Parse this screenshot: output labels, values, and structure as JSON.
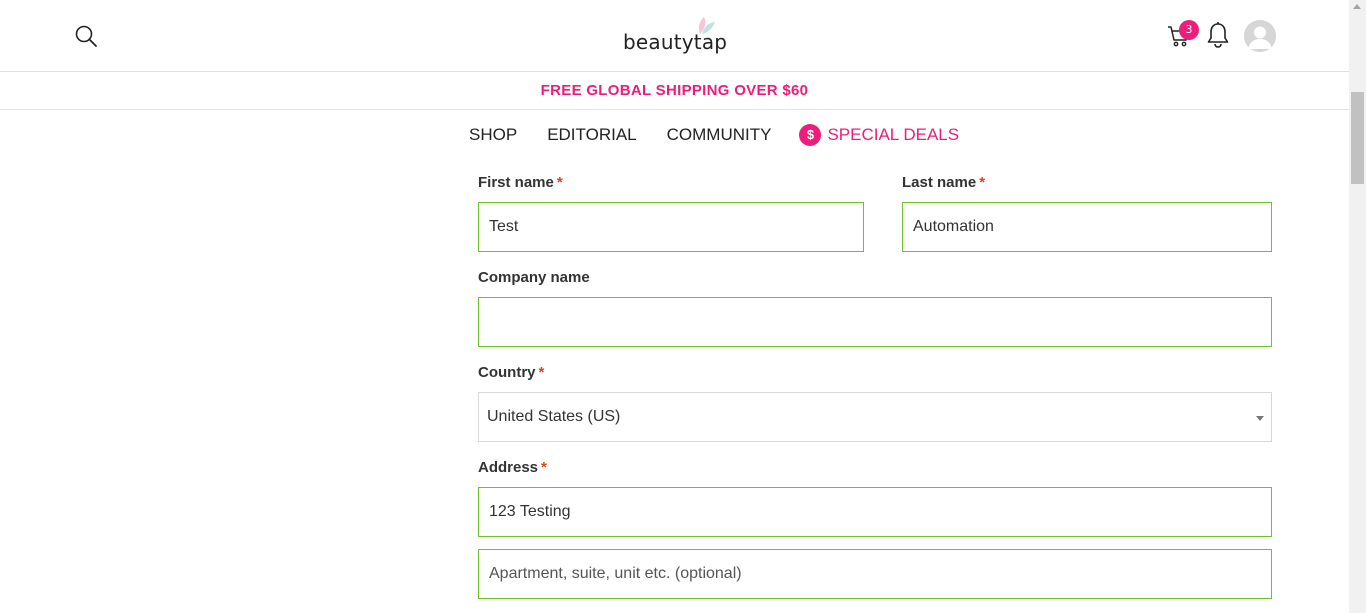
{
  "header": {
    "logo_text": "beautytap",
    "cart_count": "3",
    "icons": {
      "search": "search-icon",
      "cart": "cart-icon",
      "bell": "bell-icon",
      "avatar": "user-avatar-icon"
    }
  },
  "promo": {
    "text": "FREE GLOBAL SHIPPING OVER $60"
  },
  "nav": {
    "items": [
      {
        "label": "SHOP"
      },
      {
        "label": "EDITORIAL"
      },
      {
        "label": "COMMUNITY"
      },
      {
        "label": "SPECIAL DEALS",
        "icon_glyph": "$"
      }
    ]
  },
  "form": {
    "first_name": {
      "label": "First name",
      "required_mark": "*",
      "value": "Test"
    },
    "last_name": {
      "label": "Last name",
      "required_mark": "*",
      "value": "Automation"
    },
    "company": {
      "label": "Company name",
      "value": ""
    },
    "country": {
      "label": "Country",
      "required_mark": "*",
      "selected": "United States (US)"
    },
    "address": {
      "label": "Address",
      "required_mark": "*",
      "line1_value": "123 Testing",
      "line2_placeholder": "Apartment, suite, unit etc. (optional)"
    }
  },
  "colors": {
    "accent": "#ec1d7c",
    "valid_border": "#6dc22e",
    "required": "#e2401c"
  }
}
